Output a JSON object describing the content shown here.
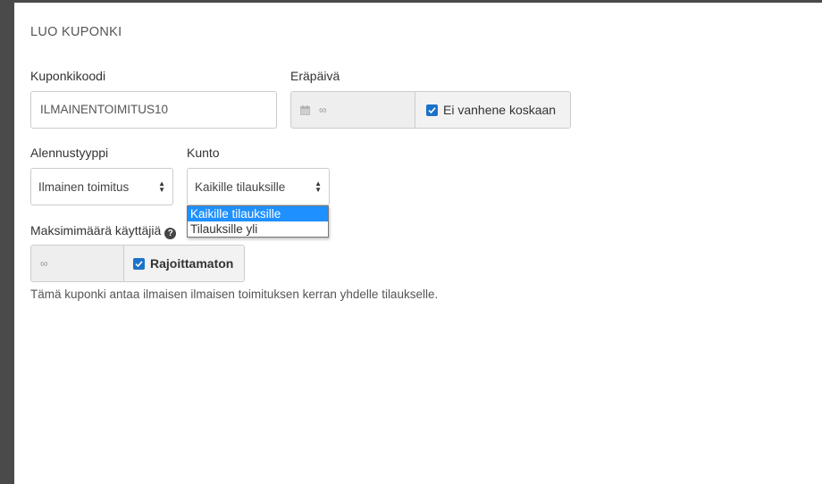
{
  "modal": {
    "title": "LUO KUPONKI"
  },
  "coupon_code": {
    "label": "Kuponkikoodi",
    "value": "ILMAINENTOIMITUS10"
  },
  "expiry": {
    "label": "Eräpäivä",
    "value": "∞",
    "icon": "calendar-icon",
    "never_expires_label": "Ei vanhene koskaan",
    "never_expires_checked": true
  },
  "discount_type": {
    "label": "Alennustyyppi",
    "selected": "Ilmainen toimitus"
  },
  "condition": {
    "label": "Kunto",
    "selected": "Kaikille tilauksille",
    "options": [
      "Kaikille tilauksille",
      "Tilauksille yli"
    ],
    "highlighted_index": 0
  },
  "max_users": {
    "label": "Maksimimäärä käyttäjiä",
    "value": "∞",
    "unlimited_label": "Rajoittamaton",
    "unlimited_checked": true,
    "help_icon": "question-circle-icon"
  },
  "info_text": "Tämä kuponki antaa ilmaisen ilmaisen toimituksen kerran yhdelle tilaukselle.",
  "colors": {
    "accent": "#1e90ff",
    "checkbox": "#1a73c8"
  }
}
